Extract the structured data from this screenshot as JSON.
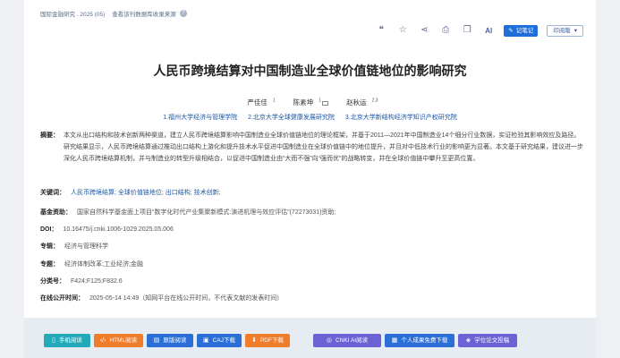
{
  "header": {
    "journal": "国际金融研究 . 2025 (05)",
    "source_link": "查看该刊数据库收录来源",
    "help_icon": "?"
  },
  "toolbar": {
    "icons": [
      "quote-icon",
      "star-icon",
      "share-icon",
      "print-icon",
      "copy-icon"
    ],
    "ai_label": "AI",
    "note_label": "记笔记",
    "print_version_label": "印阅版"
  },
  "article": {
    "title": "人民币跨境结算对中国制造业全球价值链地位的影响研究",
    "authors": [
      {
        "name": "严佳佳",
        "sup": "1"
      },
      {
        "name": "陈素坤",
        "sup": "1"
      },
      {
        "name": "赵秋运",
        "sup": "2,3"
      }
    ],
    "affiliations": [
      "1.福州大学经济与管理学院",
      "2.北京大学全球健康发展研究院",
      "3.北京大学新结构经济学知识产权研究院"
    ],
    "abstract_label": "摘要：",
    "abstract": "本文从出口结构和技术创新两种渠道，建立人民币跨境结算影响中国制造业全球价值链地位的理论框架，并基于2011—2021年中国制造业14个细分行业数据，实证检验其影响效应及路径。研究结果显示，人民币跨境结算通过推动出口结构上游化和提升技术水平促进中国制造业在全球价值链中的地位提升，并且对中低技术行业的影响更为显著。本文基于研究结果，建议进一步深化人民币跨境结算机制，并与制造业的转型升级相结合，以促进中国制造业由“大而不强”向“强而优”的战略转变，并在全球价值链中攀升至更高位置。",
    "keywords_label": "关键词：",
    "keywords": "人民币跨境结算;  全球价值链地位;  出口结构;  技术创新;",
    "fund_label": "基金资助：",
    "fund": "国家自然科学基金面上项目“数字化时代产业集聚新模式:演进机理与效应评估”(72273031)资助;",
    "doi_label": "DOI：",
    "doi": "10.16475/j.cnki.1006-1029.2025.05.006",
    "series_label": "专辑：",
    "series": "经济与管理科学",
    "topic_label": "专题：",
    "topic": "经济体制改革;工业经济;金融",
    "class_label": "分类号：",
    "class": "F424;F125;F832.6",
    "pubtime_label": "在线公开时间：",
    "pubtime": "2025-05-14 14:49（知网平台在线公开时间，不代表文献的发表时间）"
  },
  "actions": [
    {
      "label": "手机阅读",
      "icon": "phone-icon",
      "color": "#23a9b8"
    },
    {
      "label": "HTML阅读",
      "icon": "html-icon",
      "color": "#ef7d2c"
    },
    {
      "label": "原版阅读",
      "icon": "book-icon",
      "color": "#2b6fd6"
    },
    {
      "label": "CAJ下载",
      "icon": "caj-icon",
      "color": "#2b6fd6"
    },
    {
      "label": "PDF下载",
      "icon": "pdf-icon",
      "color": "#ef7d2c"
    },
    {
      "label": "CNKI AI阅读",
      "icon": "ai-icon",
      "color": "#6b62d6"
    },
    {
      "label": "个人成果免费下载",
      "icon": "person-icon",
      "color": "#2b6fd6"
    },
    {
      "label": "学位论文投稿",
      "icon": "mortarboard-icon",
      "color": "#6b62d6"
    }
  ]
}
